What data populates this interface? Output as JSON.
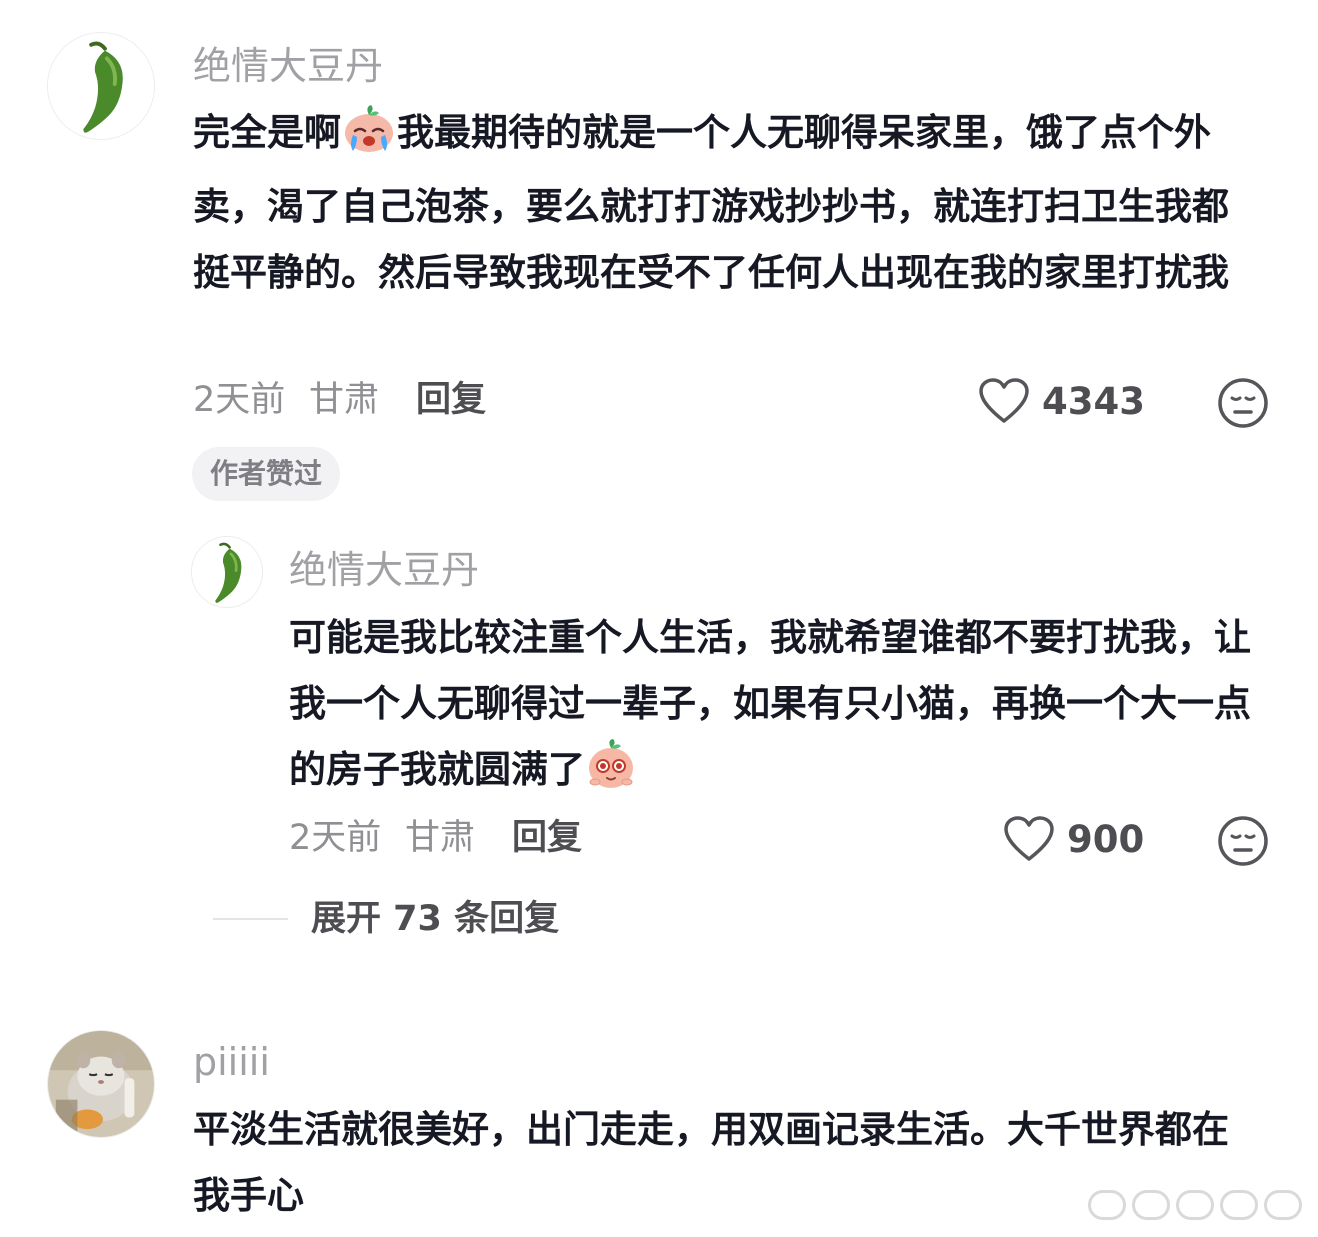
{
  "comment1": {
    "username": "绝情大豆丹",
    "text_before_emoji": "完全是啊",
    "text_after_emoji": "我最期待的就是一个人无聊得呆家里，饿了点个外卖，渴了自己泡茶，要么就打打游戏抄抄书，就连打扫卫生我都挺平静的。然后导致我现在受不了任何人出现在我的家里打扰我",
    "time": "2天前",
    "location": "甘肃",
    "reply_label": "回复",
    "like_count": "4343",
    "badge": "作者赞过",
    "emoji_icon": "crying-face-emoji",
    "avatar_icon": "green-chili-pepper"
  },
  "reply1": {
    "username": "绝情大豆丹",
    "text_before_emoji": "可能是我比较注重个人生活，我就希望谁都不要打扰我，让我一个人无聊得过一辈子，如果有只小猫，再换一个大一点的房子我就圆满了",
    "time": "2天前",
    "location": "甘肃",
    "reply_label": "回复",
    "like_count": "900",
    "emoji_icon": "teary-eyes-emoji",
    "avatar_icon": "green-chili-pepper"
  },
  "expand": {
    "label": "展开 73 条回复"
  },
  "comment2": {
    "username": "piiiii",
    "text": "平淡生活就很美好，出门走走，用双画记录生活。大千世界都在我手心",
    "avatar_icon": "hamster-photo"
  },
  "colors": {
    "text": "#161823",
    "username": "#a0a0a5",
    "meta": "#8f8f94",
    "badge_bg": "#f2f2f4"
  }
}
